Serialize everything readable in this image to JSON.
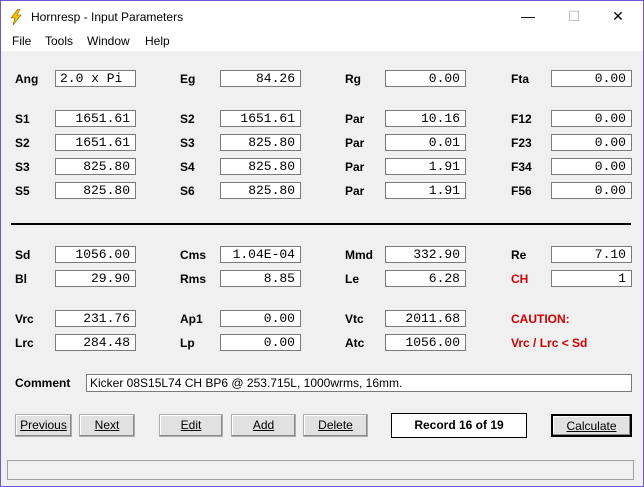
{
  "window": {
    "title": "Hornresp - Input Parameters",
    "minimize": "—",
    "maximize": "☐",
    "close": "✕"
  },
  "menu": [
    "File",
    "Tools",
    "Window",
    "Help"
  ],
  "rows": {
    "r1": [
      {
        "label": "Ang",
        "value": "2.0 x Pi"
      },
      {
        "label": "Eg",
        "value": "84.26"
      },
      {
        "label": "Rg",
        "value": "0.00"
      },
      {
        "label": "Fta",
        "value": "0.00"
      }
    ],
    "r2": [
      {
        "label": "S1",
        "value": "1651.61"
      },
      {
        "label": "S2",
        "value": "1651.61"
      },
      {
        "label": "Par",
        "value": "10.16"
      },
      {
        "label": "F12",
        "value": "0.00"
      }
    ],
    "r3": [
      {
        "label": "S2",
        "value": "1651.61"
      },
      {
        "label": "S3",
        "value": "825.80"
      },
      {
        "label": "Par",
        "value": "0.01"
      },
      {
        "label": "F23",
        "value": "0.00"
      }
    ],
    "r4": [
      {
        "label": "S3",
        "value": "825.80"
      },
      {
        "label": "S4",
        "value": "825.80"
      },
      {
        "label": "Par",
        "value": "1.91"
      },
      {
        "label": "F34",
        "value": "0.00"
      }
    ],
    "r5": [
      {
        "label": "S5",
        "value": "825.80"
      },
      {
        "label": "S6",
        "value": "825.80"
      },
      {
        "label": "Par",
        "value": "1.91"
      },
      {
        "label": "F56",
        "value": "0.00"
      }
    ],
    "r6": [
      {
        "label": "Sd",
        "value": "1056.00"
      },
      {
        "label": "Cms",
        "value": "1.04E-04"
      },
      {
        "label": "Mmd",
        "value": "332.90"
      },
      {
        "label": "Re",
        "value": "7.10"
      }
    ],
    "r7": [
      {
        "label": "Bl",
        "value": "29.90"
      },
      {
        "label": "Rms",
        "value": "8.85"
      },
      {
        "label": "Le",
        "value": "6.28"
      },
      {
        "label": "CH",
        "value": "1"
      }
    ],
    "r8": [
      {
        "label": "Vrc",
        "value": "231.76"
      },
      {
        "label": "Ap1",
        "value": "0.00"
      },
      {
        "label": "Vtc",
        "value": "2011.68"
      }
    ],
    "r9": [
      {
        "label": "Lrc",
        "value": "284.48"
      },
      {
        "label": "Lp",
        "value": "0.00"
      },
      {
        "label": "Atc",
        "value": "1056.00"
      }
    ]
  },
  "caution": {
    "title": "CAUTION:",
    "message": "Vrc / Lrc < Sd",
    "color": "#cc0000"
  },
  "comment": {
    "label": "Comment",
    "value": "Kicker 08S15L74 CH BP6 @ 253.715L, 1000wrms, 16mm."
  },
  "buttons": {
    "previous": "Previous",
    "next": "Next",
    "edit": "Edit",
    "add": "Add",
    "delete": "Delete",
    "calculate": "Calculate"
  },
  "record": "Record 16 of 19",
  "icons": {
    "app": "lightning-bolt-icon"
  }
}
